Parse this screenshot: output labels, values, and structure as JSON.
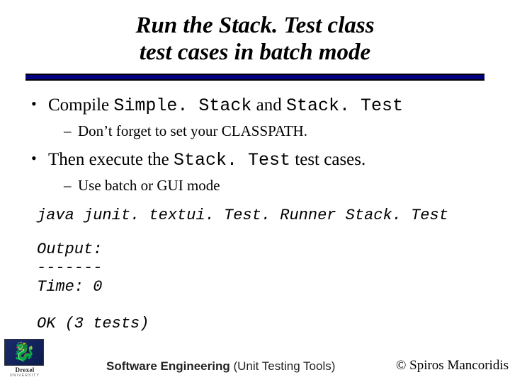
{
  "title": {
    "line1": "Run the Stack. Test class",
    "line2": "test cases in batch mode"
  },
  "bullets": {
    "b1_pre": "Compile ",
    "b1_code1": "Simple. Stack",
    "b1_mid": " and ",
    "b1_code2": "Stack. Test",
    "b1_sub": "Don’t forget to set your CLASSPATH.",
    "b2_pre": "Then execute the ",
    "b2_code": "Stack. Test",
    "b2_post": " test cases.",
    "b2_sub": "Use batch or GUI mode"
  },
  "command": "java junit. textui. Test. Runner Stack. Test",
  "output": "Output:\n-------\nTime: 0\n\nOK (3 tests)",
  "logo": {
    "name": "Drexel",
    "sub": "UNIVERSITY"
  },
  "footer": {
    "center_bold": "Software Engineering",
    "center_rest": " (Unit Testing Tools)",
    "right": "© Spiros Mancoridis"
  }
}
